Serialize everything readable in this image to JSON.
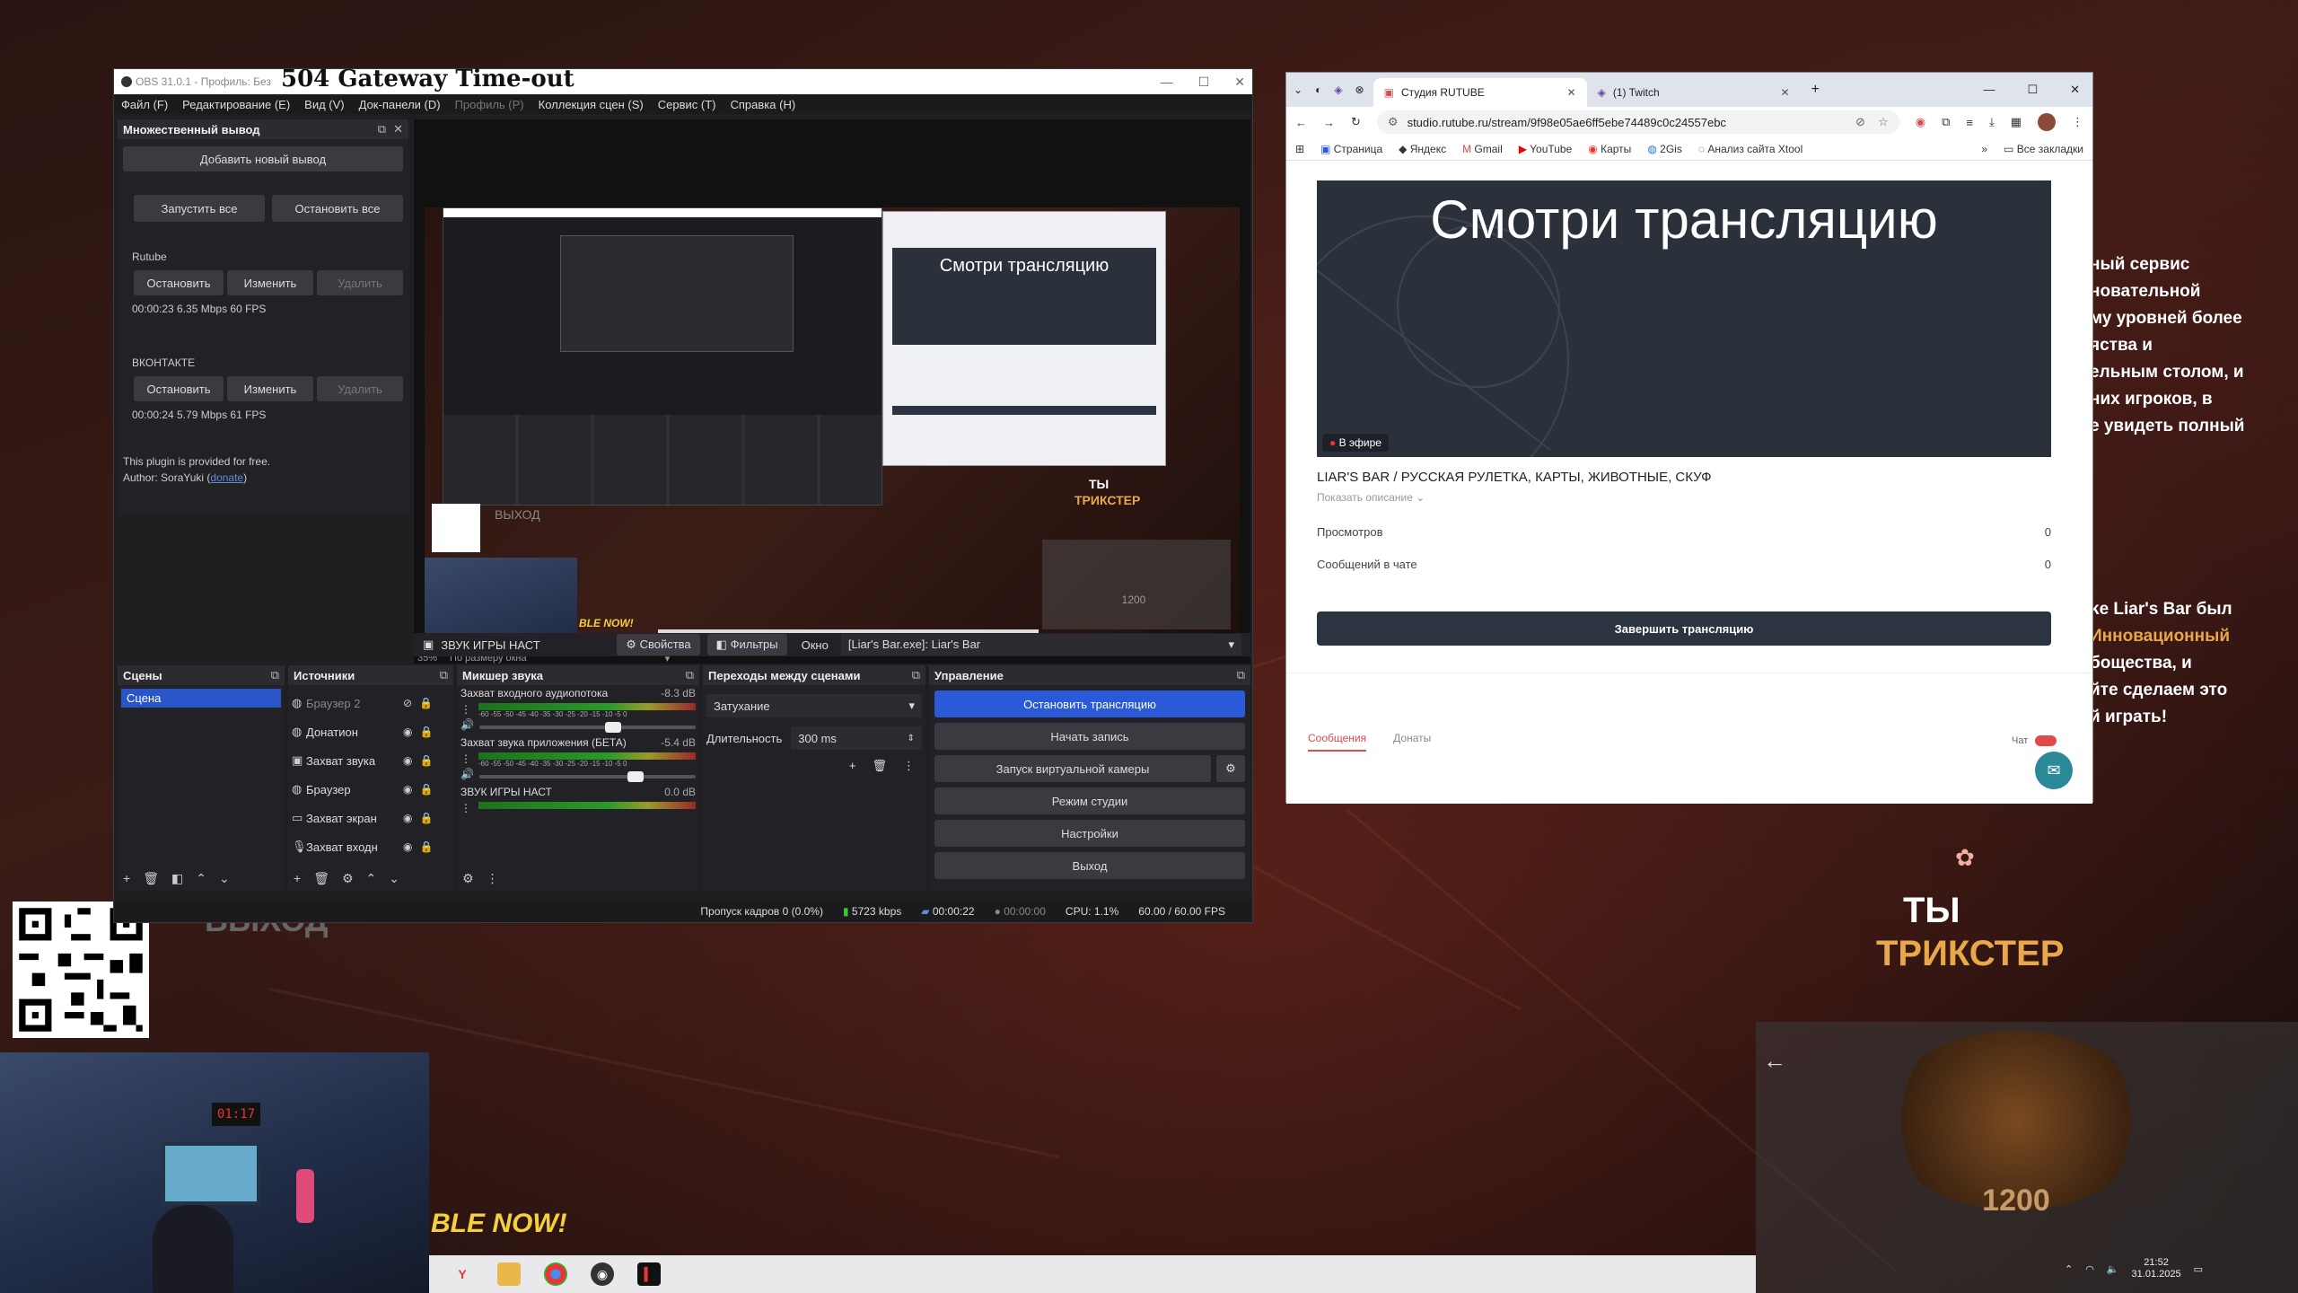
{
  "obs": {
    "title_small": "OBS 31.0.1 - Профиль: Без",
    "title_overlay": "504 Gateway Time-out",
    "menu": [
      "Файл (F)",
      "Редактирование (E)",
      "Вид (V)",
      "Док-панели (D)",
      "Профиль (P)",
      "Коллекция сцен (S)",
      "Сервис (T)",
      "Справка (H)"
    ],
    "multi_output": {
      "title": "Множественный вывод",
      "add_button": "Добавить новый вывод",
      "start_all": "Запустить все",
      "stop_all": "Остановить все",
      "outputs": [
        {
          "name": "Rutube",
          "stop": "Остановить",
          "edit": "Изменить",
          "delete": "Удалить",
          "stats": "00:00:23  6.35 Mbps  60 FPS"
        },
        {
          "name": "ВКОНТАКТЕ",
          "stop": "Остановить",
          "edit": "Изменить",
          "delete": "Удалить",
          "stats": "00:00:24  5.79 Mbps  61 FPS"
        }
      ],
      "plugin_note": "This plugin is provided for free.",
      "author_prefix": "Author: SoraYuki (",
      "author_link": "donate",
      "author_suffix": ")"
    },
    "preview": {
      "zoom": "35%",
      "fit": "По размеру окна",
      "preview_heading": "Смотри трансляцию",
      "preview_exit": "ВЫХОД",
      "preview_ty": "ТЫ",
      "preview_trickster": "ТРИКСТЕР",
      "preview_score": "1200",
      "preview_able_now": "BLE NOW!"
    },
    "source_toolbar": {
      "source_name": "ЗВУК ИГРЫ НАСТ",
      "properties": "Свойства",
      "filters": "Фильтры",
      "window_label": "Окно",
      "window_value": "[Liar's Bar.exe]: Liar's Bar"
    },
    "scenes": {
      "title": "Сцены",
      "items": [
        "Сцена"
      ]
    },
    "sources": {
      "title": "Источники",
      "items": [
        "Браузер 2",
        "Донатион",
        "Захват звука",
        "Браузер",
        "Захват экран",
        "Захват входн"
      ]
    },
    "mixer": {
      "title": "Микшер звука",
      "tracks": [
        {
          "name": "Захват входного аудиопотока",
          "db": "-8.3 dB",
          "level": 0.62
        },
        {
          "name": "Захват звука приложения (БЕТА)",
          "db": "-5.4 dB",
          "level": 0.72
        },
        {
          "name": "ЗВУК ИГРЫ НАСТ",
          "db": "0.0 dB",
          "level": 0.5
        }
      ],
      "scale": "-60 -55 -50 -45 -40 -35 -30 -25 -20 -15 -10 -5 0"
    },
    "transitions": {
      "title": "Переходы между сценами",
      "type": "Затухание",
      "duration_label": "Длительность",
      "duration_value": "300 ms"
    },
    "controls": {
      "title": "Управление",
      "buttons": [
        "Остановить трансляцию",
        "Начать запись",
        "Запуск виртуальной камеры",
        "Режим студии",
        "Настройки",
        "Выход"
      ]
    },
    "status": {
      "dropped": "Пропуск кадров 0 (0.0%)",
      "bitrate": "5723 kbps",
      "stream_time": "00:00:22",
      "rec_time": "00:00:00",
      "cpu": "CPU: 1.1%",
      "fps": "60.00 / 60.00 FPS"
    }
  },
  "browser": {
    "tabs": [
      {
        "title": "Студия RUTUBE",
        "active": true
      },
      {
        "title": "(1) Twitch",
        "active": false
      }
    ],
    "url": "studio.rutube.ru/stream/9f98e05ae6ff5ebe74489c0c24557ebc",
    "bookmarks": [
      "Страница",
      "Яндекс",
      "Gmail",
      "YouTube",
      "Карты",
      "2Gis",
      "Анализ сайта Xtool"
    ],
    "all_bookmarks": "Все закладки",
    "video_heading": "Смотри трансляцию",
    "live_badge": "В эфире",
    "stream_name": "LIAR'S BAR / РУССКАЯ РУЛЕТКА, КАРТЫ, ЖИВОТНЫЕ, СКУФ",
    "show_description": "Показать описание",
    "stats": [
      {
        "label": "Просмотров",
        "value": "0"
      },
      {
        "label": "Сообщений в чате",
        "value": "0"
      }
    ],
    "end_button": "Завершить трансляцию",
    "sub_tabs": [
      "Сообщения",
      "Донаты"
    ],
    "chat_label": "Чат"
  },
  "desktop": {
    "side_text": [
      "ный сервис",
      "новательной",
      "му уровней более",
      "яства и",
      "ельным столом, и",
      "них игроков, в",
      "е увидеть полный"
    ],
    "side_text2": [
      "ke Liar's Bar был",
      "Инновационный",
      "бощества, и",
      "йте сделаем это",
      "й играть!"
    ],
    "exit": "ВЫХОД",
    "able_now": "BLE NOW!",
    "ty": "ТЫ",
    "trickster": "ТРИКСТЕР",
    "score": "1200",
    "clock_time": "21:52",
    "clock_date": "31.01.2025",
    "room_clock": "01:17"
  },
  "colors": {
    "accent": "#2a5ad8",
    "rutube_red": "#e04a4a",
    "gold": "#e8a84a"
  }
}
